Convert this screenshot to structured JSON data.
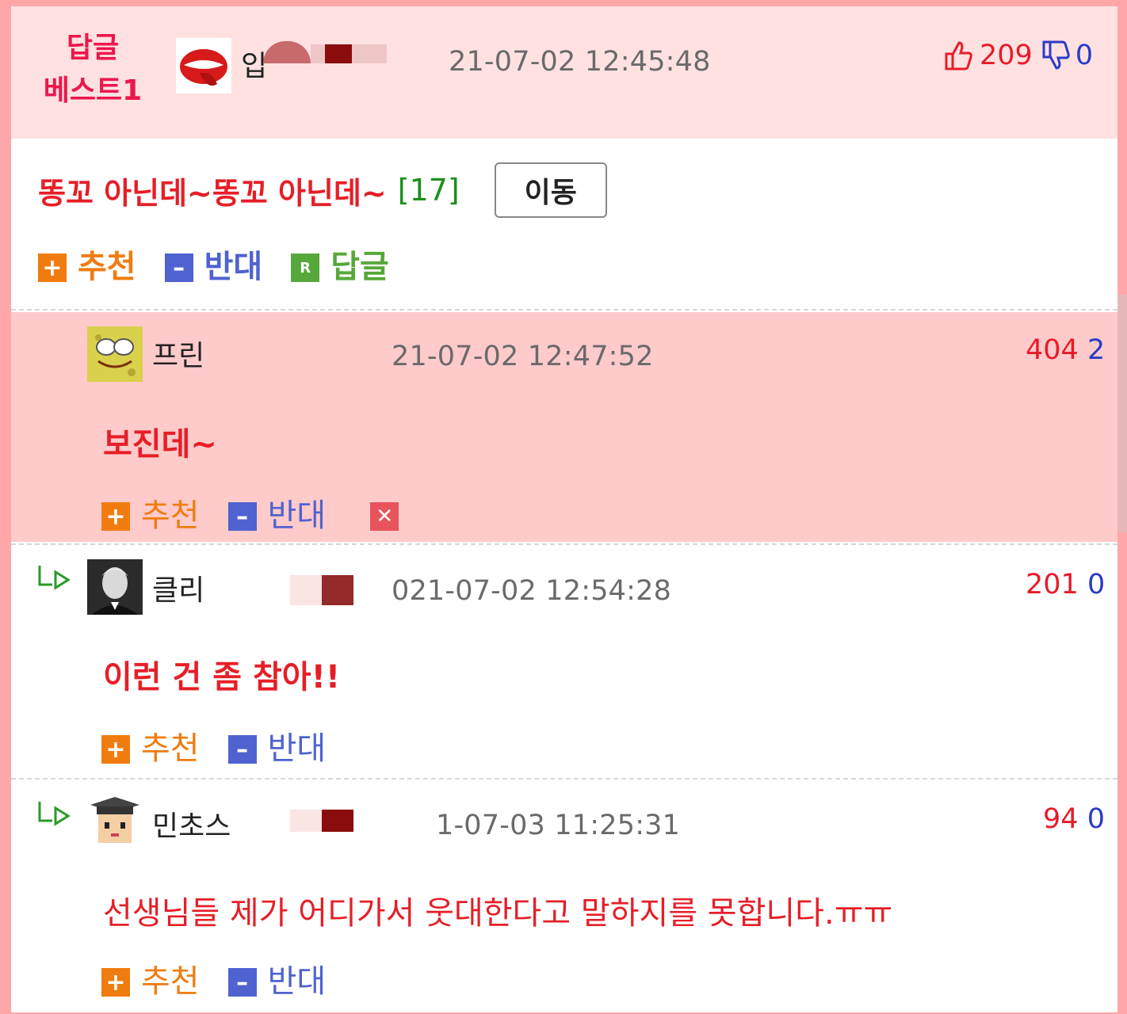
{
  "best": {
    "label_line1": "답글",
    "label_line2": "베스트1",
    "nick": "입",
    "date": "21-07-02 12:45:48",
    "up": "209",
    "down": "0",
    "post_title": "똥꼬 아닌데~똥꼬 아닌데~",
    "post_count": "[17]",
    "move_label": "이동",
    "actions": {
      "recommend": "추천",
      "oppose": "반대",
      "reply": "답글"
    }
  },
  "comments": [
    {
      "nick": "프린",
      "date": "21-07-02 12:47:52",
      "up": "404",
      "down": "2",
      "text": "보진데~",
      "actions": {
        "recommend": "추천",
        "oppose": "반대"
      }
    },
    {
      "nick": "클리",
      "date": "021-07-02 12:54:28",
      "up": "201",
      "down": "0",
      "text": "이런 건 좀 참아!!",
      "actions": {
        "recommend": "추천",
        "oppose": "반대"
      }
    },
    {
      "nick": "민초스",
      "date": "1-07-03 11:25:31",
      "up": "94",
      "down": "0",
      "text": "선생님들 제가 어디가서 웃대한다고 말하지를 못합니다.ㅠㅠ",
      "actions": {
        "recommend": "추천",
        "oppose": "반대"
      }
    }
  ],
  "colors": {
    "frame": "#ffa7a8",
    "best_bg": "#ffe1e2",
    "highlight_bg": "#ffcaca",
    "accent_red": "#e61e27"
  },
  "icons": [
    "thumbs-up-icon",
    "thumbs-down-icon",
    "plus-icon",
    "minus-icon",
    "reply-icon",
    "close-icon",
    "reply-arrow-icon"
  ]
}
